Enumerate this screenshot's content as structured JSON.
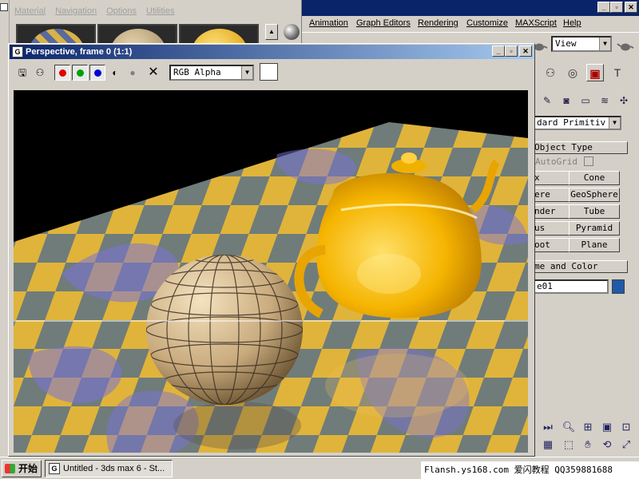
{
  "material_editor": {
    "menu": [
      "Material",
      "Navigation",
      "Options",
      "Utilities"
    ]
  },
  "main_window": {
    "menu": [
      "Animation",
      "Graph Editors",
      "Rendering",
      "Customize",
      "MAXScript",
      "Help"
    ],
    "window_buttons": [
      "_",
      "▫",
      "✕"
    ],
    "viewport_select": "View"
  },
  "command_panel": {
    "category": "dard Primitiv",
    "object_type_header": "Object Type",
    "autogrid_label": "AutoGrid",
    "buttons_left": [
      "x",
      "ere",
      "nder",
      "us",
      "oot"
    ],
    "buttons_right": [
      "Cone",
      "GeoSphere",
      "Tube",
      "Pyramid",
      "Plane"
    ],
    "name_color_header": "me and Color",
    "object_name": "e01",
    "color_swatch": "#1e5aa8"
  },
  "render_window": {
    "title": "Perspective, frame 0 (1:1)",
    "icon_letter": "G",
    "channel": "RGB Alpha",
    "channel_colors": {
      "red": "#e00000",
      "green": "#00a000",
      "blue": "#0000d0"
    },
    "window_buttons": [
      "_",
      "▫",
      "✕"
    ]
  },
  "taskbar": {
    "start_label": "开始",
    "task_label": "Untitled - 3ds max 6 - St...",
    "watermark": "Flansh.ys168.com 爱闪教程 QQ359881688"
  }
}
